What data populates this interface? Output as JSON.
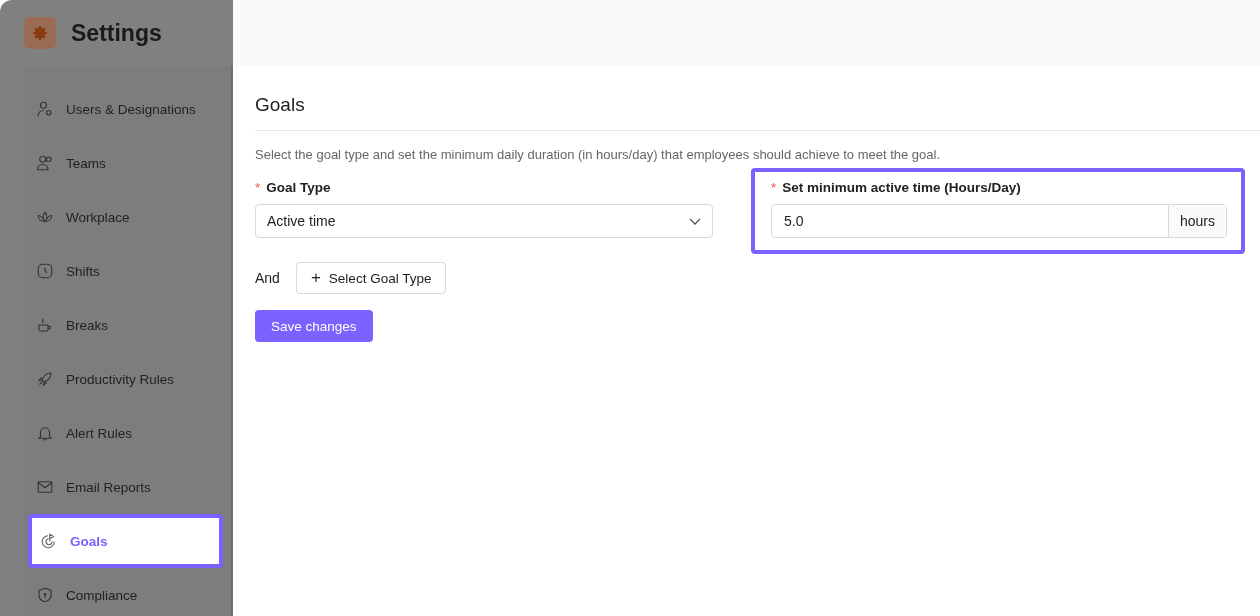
{
  "header": {
    "title": "Settings"
  },
  "sidebar": {
    "items": [
      {
        "label": "Users & Designations",
        "selected": false
      },
      {
        "label": "Teams",
        "selected": false
      },
      {
        "label": "Workplace",
        "selected": false
      },
      {
        "label": "Shifts",
        "selected": false
      },
      {
        "label": "Breaks",
        "selected": false
      },
      {
        "label": "Productivity Rules",
        "selected": false
      },
      {
        "label": "Alert Rules",
        "selected": false
      },
      {
        "label": "Email Reports",
        "selected": false
      },
      {
        "label": "Goals",
        "selected": true
      },
      {
        "label": "Compliance",
        "selected": false
      }
    ]
  },
  "page": {
    "title": "Goals",
    "description": "Select the goal type and set the minimum daily duration (in hours/day) that employees should achieve to meet the goal.",
    "goal_type": {
      "required_mark": "*",
      "label": "Goal Type",
      "value": "Active time",
      "highlighted": false
    },
    "min_time": {
      "required_mark": "*",
      "label": "Set minimum active time (Hours/Day)",
      "value": "5.0",
      "suffix": "hours",
      "highlighted": true
    },
    "and_label": "And",
    "add_button": {
      "icon": "+",
      "label": "Select Goal Type"
    },
    "save_button": "Save changes"
  }
}
